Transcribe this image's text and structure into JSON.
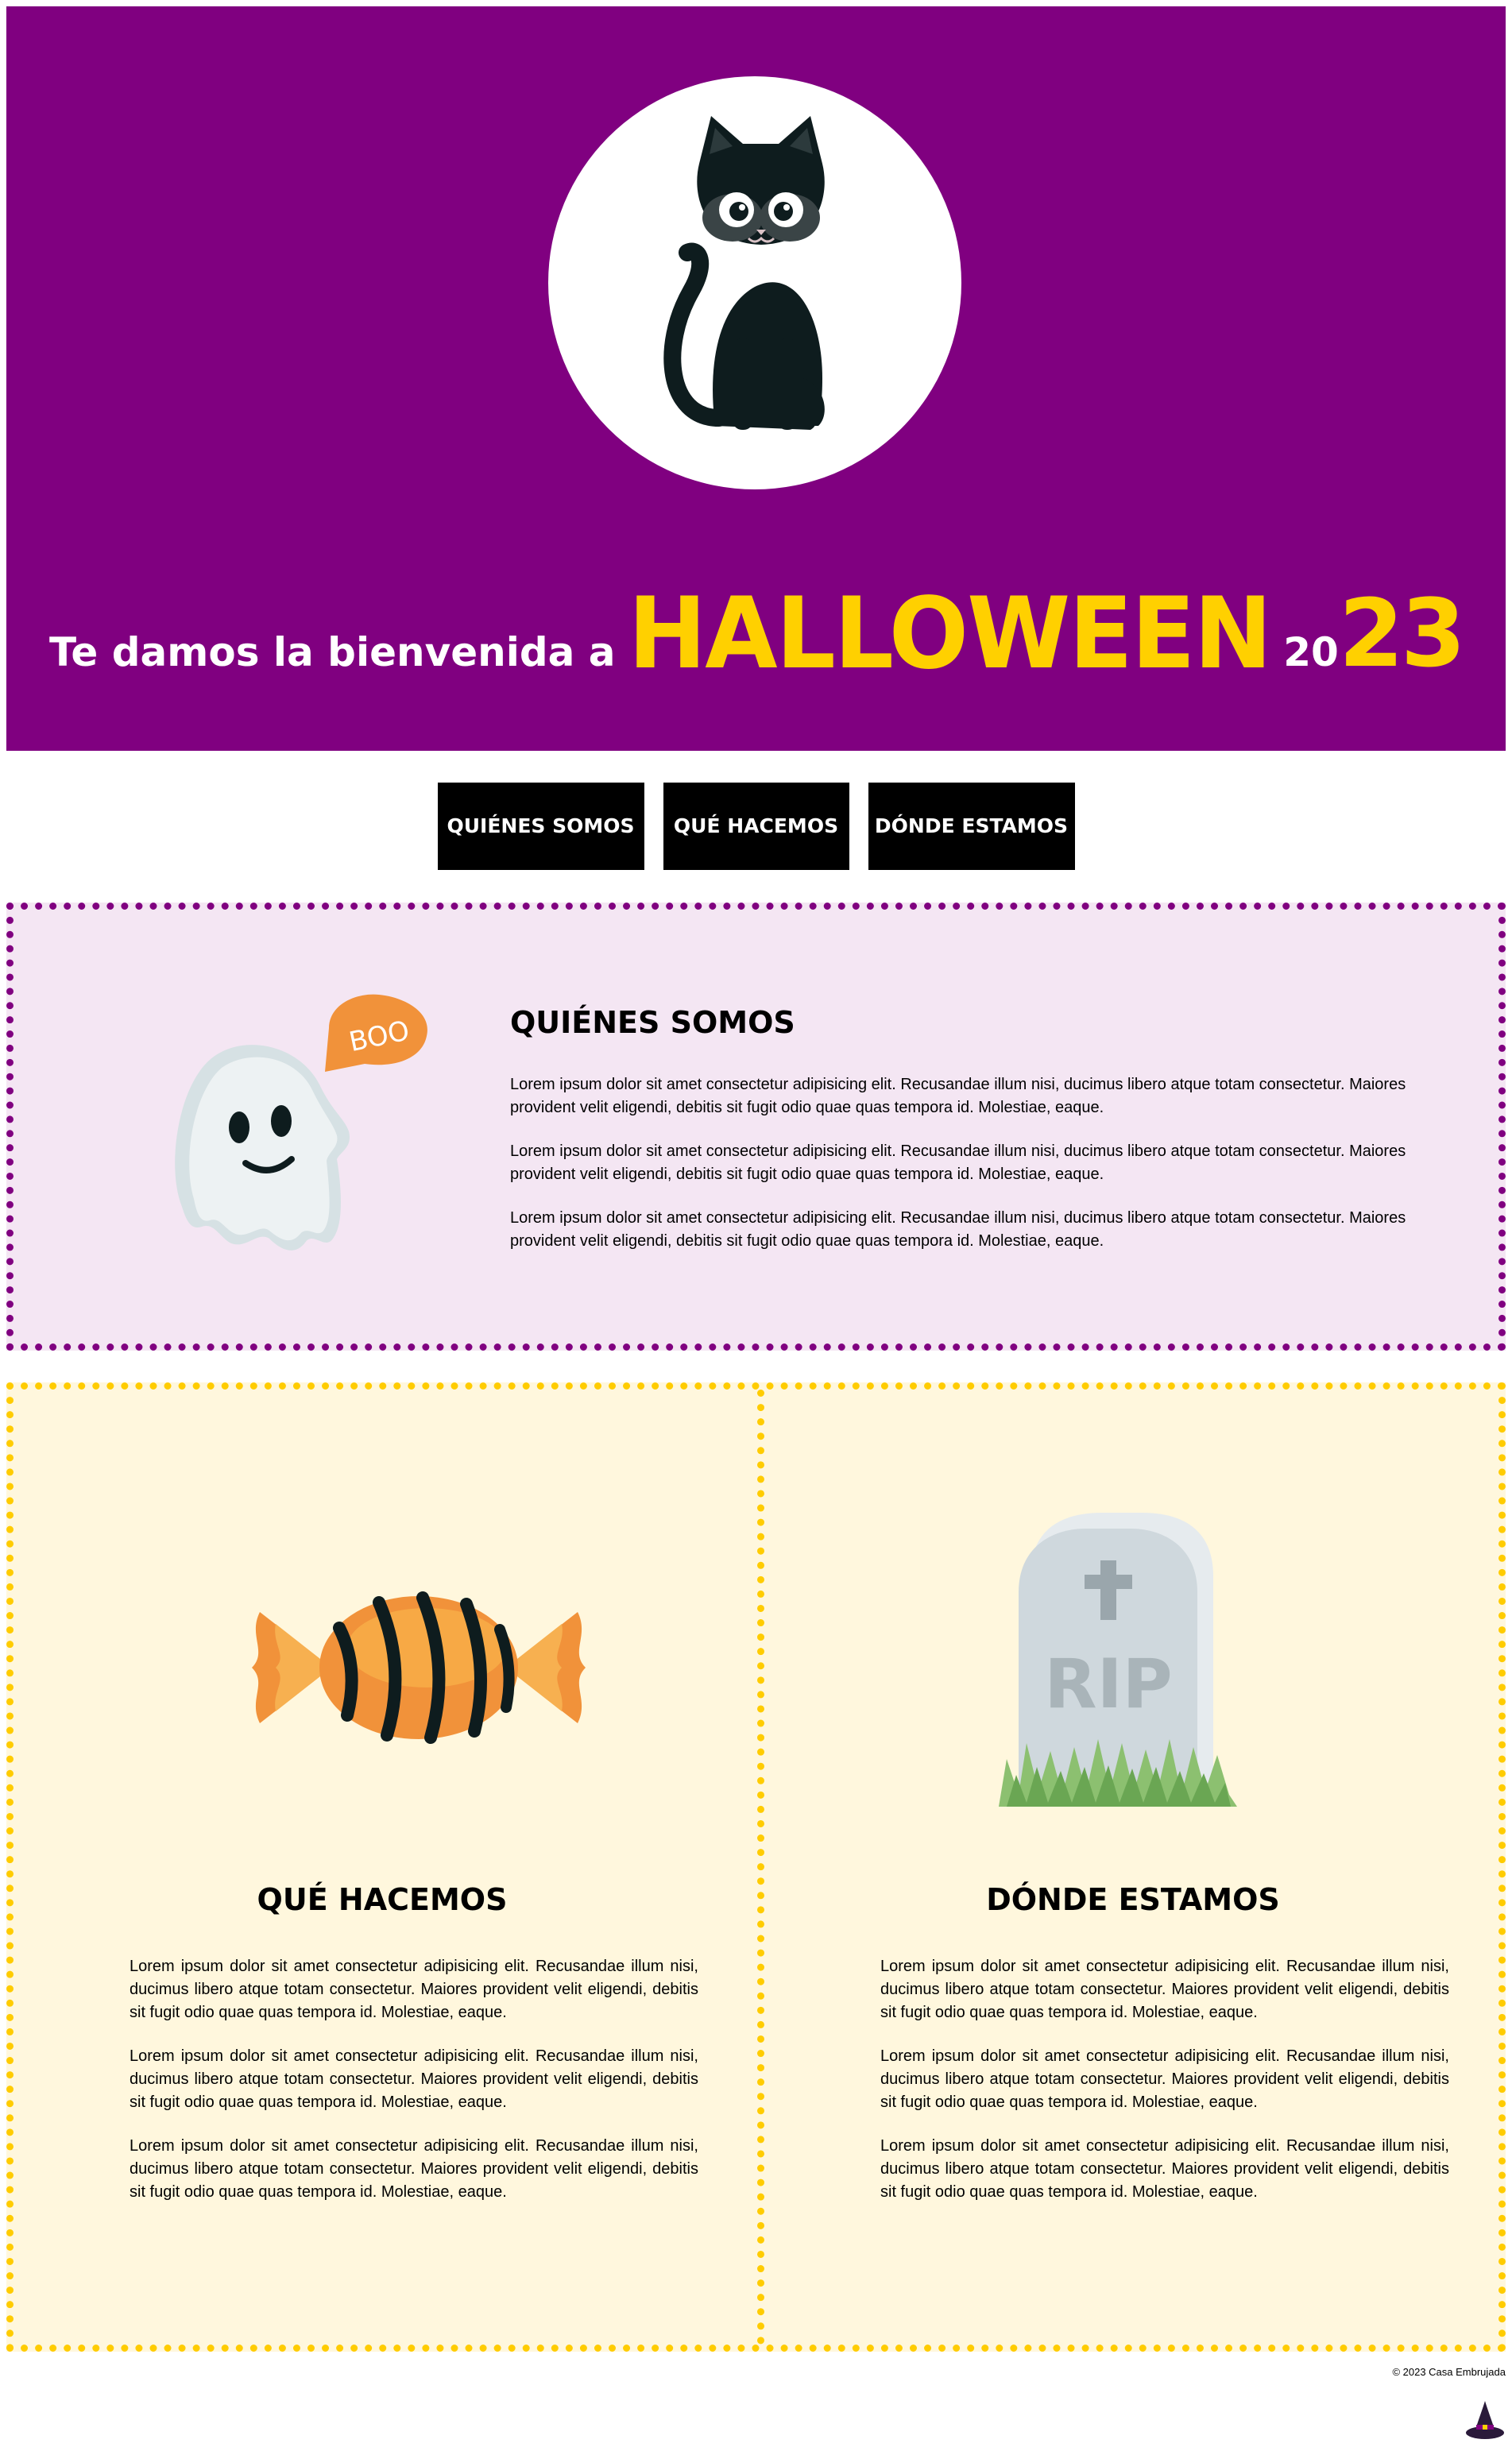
{
  "header": {
    "welcome_text": "Te damos la bienvenida a",
    "event_name": "HALLOWEEN",
    "year_prefix": "20",
    "year_suffix": "23",
    "background_color": "#800080",
    "accent_color": "#ffd000"
  },
  "nav": {
    "items": [
      {
        "label": "QUIÉNES SOMOS"
      },
      {
        "label": "QUÉ HACEMOS"
      },
      {
        "label": "DÓNDE ESTAMOS"
      }
    ]
  },
  "quienes": {
    "title": "QUIÉNES SOMOS",
    "bubble_text": "BOO",
    "paragraphs": [
      "Lorem ipsum dolor sit amet consectetur adipisicing elit. Recusandae illum nisi, ducimus libero atque totam consectetur. Maiores provident velit eligendi, debitis sit fugit odio quae quas tempora id. Molestiae, eaque.",
      "Lorem ipsum dolor sit amet consectetur adipisicing elit. Recusandae illum nisi, ducimus libero atque totam consectetur. Maiores provident velit eligendi, debitis sit fugit odio quae quas tempora id. Molestiae, eaque.",
      "Lorem ipsum dolor sit amet consectetur adipisicing elit. Recusandae illum nisi, ducimus libero atque totam consectetur. Maiores provident velit eligendi, debitis sit fugit odio quae quas tempora id. Molestiae, eaque."
    ]
  },
  "que_hacemos": {
    "title": "QUÉ HACEMOS",
    "paragraphs": [
      "Lorem ipsum dolor sit amet consectetur adipisicing elit. Recusandae illum nisi, ducimus libero atque totam consectetur. Maiores provident velit eligendi, debitis sit fugit odio quae quas tempora id. Molestiae, eaque.",
      "Lorem ipsum dolor sit amet consectetur adipisicing elit. Recusandae illum nisi, ducimus libero atque totam consectetur. Maiores provident velit eligendi, debitis sit fugit odio quae quas tempora id. Molestiae, eaque.",
      "Lorem ipsum dolor sit amet consectetur adipisicing elit. Recusandae illum nisi, ducimus libero atque totam consectetur. Maiores provident velit eligendi, debitis sit fugit odio quae quas tempora id. Molestiae, eaque."
    ]
  },
  "donde_estamos": {
    "title": "DÓNDE ESTAMOS",
    "tomb_text": "RIP",
    "paragraphs": [
      "Lorem ipsum dolor sit amet consectetur adipisicing elit. Recusandae illum nisi, ducimus libero atque totam consectetur. Maiores provident velit eligendi, debitis sit fugit odio quae quas tempora id. Molestiae, eaque.",
      "Lorem ipsum dolor sit amet consectetur adipisicing elit. Recusandae illum nisi, ducimus libero atque totam consectetur. Maiores provident velit eligendi, debitis sit fugit odio quae quas tempora id. Molestiae, eaque.",
      "Lorem ipsum dolor sit amet consectetur adipisicing elit. Recusandae illum nisi, ducimus libero atque totam consectetur. Maiores provident velit eligendi, debitis sit fugit odio quae quas tempora id. Molestiae, eaque."
    ]
  },
  "footer": {
    "copyright": "© 2023 Casa Embrujada"
  },
  "icons": [
    "black-cat-icon",
    "ghost-icon",
    "candy-icon",
    "tombstone-icon",
    "witch-hat-icon"
  ]
}
